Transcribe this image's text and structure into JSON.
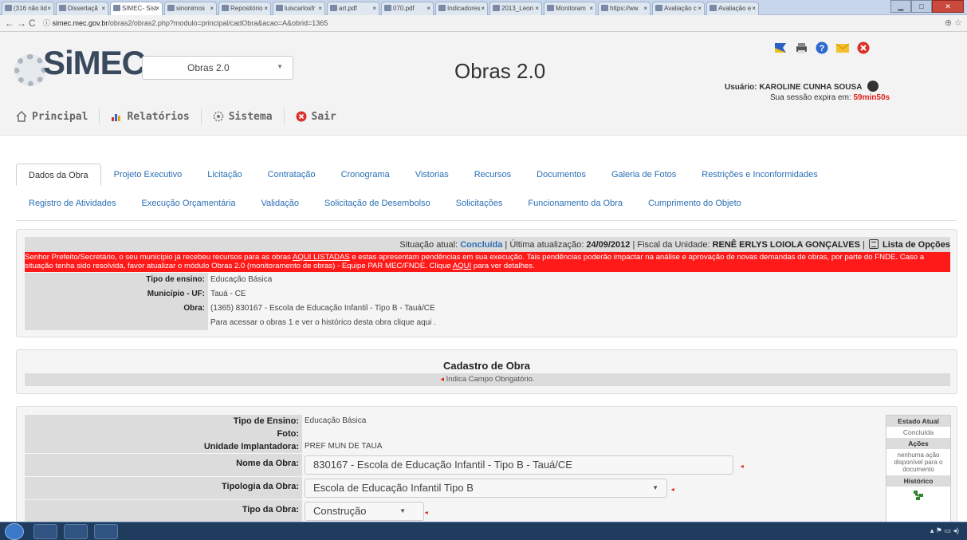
{
  "browser": {
    "tabs": [
      {
        "label": "(316 não lid"
      },
      {
        "label": "Dissertaçã"
      },
      {
        "label": "SIMEC- Sist"
      },
      {
        "label": "sinonimos"
      },
      {
        "label": "Repositório"
      },
      {
        "label": "luiscarlosfr"
      },
      {
        "label": "art.pdf"
      },
      {
        "label": "070.pdf"
      },
      {
        "label": "Indicadores"
      },
      {
        "label": "2013_Leon"
      },
      {
        "label": "Monitoram"
      },
      {
        "label": "https://ww"
      },
      {
        "label": "Avaliação c"
      },
      {
        "label": "Avaliação e"
      }
    ],
    "url_host": "simec.mec.gov.br",
    "url_path": "/obras2/obras2.php?modulo=principal/cadObra&acao=A&obrid=1365"
  },
  "header": {
    "logo": "SiMEC",
    "module_select": "Obras 2.0",
    "title": "Obras 2.0",
    "user_label": "Usuário:",
    "user_name": "KAROLINE CUNHA SOUSA",
    "session_label": "Sua sessão expira em:",
    "session_time": "59min50s"
  },
  "main_menu": [
    {
      "label": "Principal",
      "icon": "home-icon"
    },
    {
      "label": "Relatórios",
      "icon": "report-icon"
    },
    {
      "label": "Sistema",
      "icon": "settings-icon"
    },
    {
      "label": "Sair",
      "icon": "exit-icon"
    }
  ],
  "tabs_row1": [
    "Dados da Obra",
    "Projeto Executivo",
    "Licitação",
    "Contratação",
    "Cronograma",
    "Vistorias",
    "Recursos",
    "Documentos",
    "Galeria de Fotos",
    "Restrições e Inconformidades"
  ],
  "tabs_row2": [
    "Registro de Atividades",
    "Execução Orçamentária",
    "Validação",
    "Solicitação de Desembolso",
    "Solicitações",
    "Funcionamento da Obra",
    "Cumprimento do Objeto"
  ],
  "status": {
    "situacao_label": "Situação atual:",
    "situacao_value": "Concluída",
    "atualizacao_label": "| Última atualização:",
    "atualizacao_value": "24/09/2012",
    "fiscal_label": "| Fiscal da Unidade:",
    "fiscal_value": "RENÊ ERLYS LOIOLA GONÇALVES",
    "opcoes_sep": "|",
    "opcoes_label": "Lista de Opções"
  },
  "alert": {
    "part1": "Senhor Prefeito/Secretário, o seu município já recebeu recursos para as obras ",
    "link1": "AQUI LISTADAS",
    "part2": " e estas apresentam pendências em sua execução. Tais pendências poderão impactar na análise e aprovação de novas demandas de obras, por parte do FNDE. Caso a situação tenha sido resolvida, favor atualizar o módulo Obras 2.0 (monitoramento de obras) - Equipe PAR MEC/FNDE. Clique ",
    "link2": "AQUI",
    "part3": " para ver detalhes."
  },
  "info": {
    "tipo_ensino_label": "Tipo de ensino:",
    "tipo_ensino_value": "Educação Básica",
    "municipio_label": "Município - UF:",
    "municipio_value": "Tauá - CE",
    "obra_label": "Obra:",
    "obra_value": "(1365) 830167 - Escola de Educação Infantil - Tipo B - Tauá/CE",
    "acesso_text": "Para acessar o obras 1 e ver o histórico desta obra clique aqui ."
  },
  "cadastro": {
    "title": "Cadastro de Obra",
    "required_note": "Indica Campo Obrigatório."
  },
  "form": {
    "tipo_ensino_label": "Tipo de Ensino:",
    "tipo_ensino_value": "Educação Básica",
    "foto_label": "Foto:",
    "unidade_label": "Unidade Implantadora:",
    "unidade_value": "PREF MUN DE TAUA",
    "nome_label": "Nome da Obra:",
    "nome_value": "830167 - Escola de Educação Infantil - Tipo B - Tauá/CE",
    "tipologia_label": "Tipologia da Obra:",
    "tipologia_value": "Escola de Educação Infantil Tipo B",
    "tipo_obra_label": "Tipo da Obra:",
    "tipo_obra_value": "Construção"
  },
  "side_box": {
    "estado_label": "Estado Atual",
    "estado_value": "Concluída",
    "acoes_label": "Ações",
    "acoes_value": "nenhuma ação disponível para o documento",
    "historico_label": "Histórico"
  },
  "colors": {
    "accent_link": "#2a6fb5",
    "alert_bg": "#ff1a1a",
    "session_time": "#e0201b"
  }
}
